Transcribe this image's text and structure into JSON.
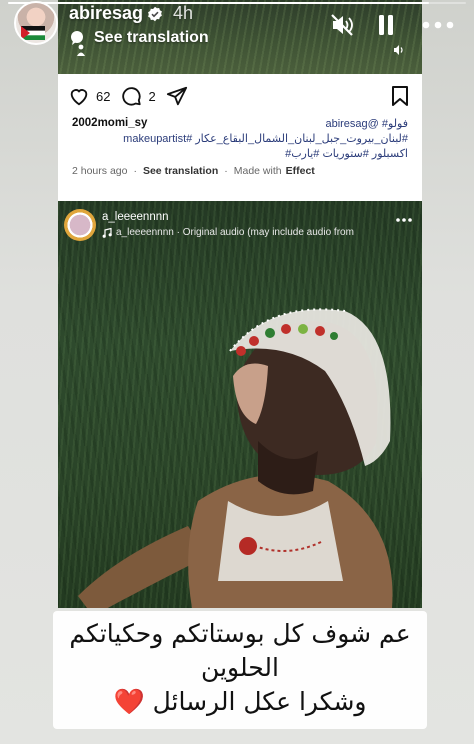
{
  "story": {
    "username": "abiresag",
    "time": "4h",
    "see_translation": "See translation",
    "progress": 0.92
  },
  "post": {
    "like_count": "62",
    "comment_count": "2",
    "caption_user": "2002momi_sy",
    "caption_line1": "فولو# @abiresag",
    "caption_line2": "#لبنان_بيروت_جبل_لبنان_الشمال_البقاع_عكار #makeupartist",
    "caption_line3": "اكسبلور #ستوريات #يارب#",
    "meta_time": "2 hours ago",
    "meta_translation": "See translation",
    "meta_made_with": "Made with",
    "meta_effect": "Effect"
  },
  "reel": {
    "username": "a_leeeennnn",
    "audio": "a_leeeennnn · Original audio  (may include audio from"
  },
  "sticker": {
    "line1": "عم شوف كل بوستاتكم وحكياتكم",
    "line2": "الحلوين",
    "line3": "وشكرا عكل الرسائل",
    "heart": "❤️"
  },
  "icons": {
    "verified": "verified-badge-icon",
    "mute": "speaker-muted-icon",
    "pause": "pause-icon",
    "more": "more-options-icon",
    "like": "heart-outline-icon",
    "comment": "comment-bubble-icon",
    "share": "paper-plane-icon",
    "save": "bookmark-icon"
  }
}
